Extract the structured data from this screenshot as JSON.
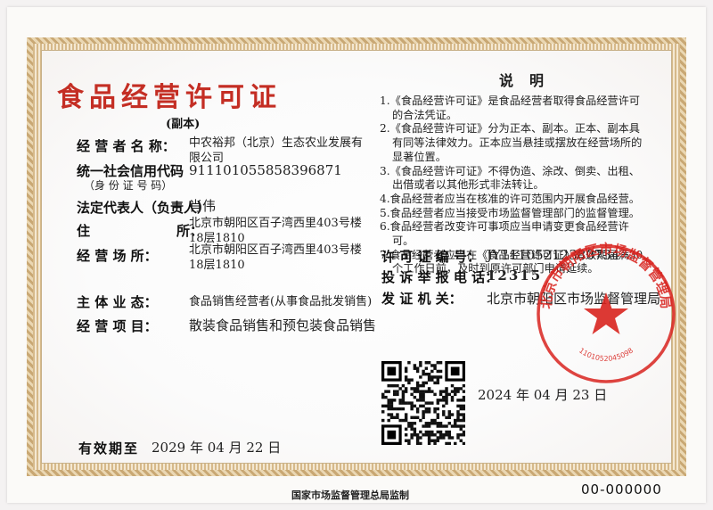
{
  "license": {
    "title": "食品经营许可证",
    "subtitle": "(副本)",
    "operator_label": "经 营 者 名 称：",
    "operator_value": "中农裕邦（北京）生态农业发展有限公司",
    "credit_code_label": "统一社会信用代码",
    "credit_code_sub": "（身 份 证 号 码）",
    "credit_code_value": "911101055858396871",
    "legal_rep_label": "法定代表人（负责人）",
    "legal_rep_value": "肖伟",
    "address_label": "住             所：",
    "address_value": "北京市朝阳区百子湾西里403号楼18层1810",
    "premises_label": "经   营   场   所：",
    "premises_value": "北京市朝阳区百子湾西里403号楼18层1810",
    "main_type_label": "主    体    业    态：",
    "main_type_value": "食品销售经营者(从事食品批发销售)",
    "items_label": "经    营    项    目：",
    "items_value": "散装食品销售和预包装食品销售",
    "validity_label": "有效期至",
    "validity_value": "2029 年 04 月 22 日"
  },
  "notes": {
    "title": "说明",
    "items": [
      "1.《食品经营许可证》是食品经营者取得食品经营许可的合法凭证。",
      "2.《食品经营许可证》分为正本、副本。正本、副本具有同等法律效力。正本应当悬挂或摆放在经营场所的显著位置。",
      "3.《食品经营许可证》不得伪造、涂改、倒卖、出租、出借或者以其他形式非法转让。",
      "4.食品经营者应当在核准的许可范围内开展食品经营。",
      "5.食品经营者应当接受市场监督管理部门的监督管理。",
      "6.食品经营者改变许可事项应当申请变更食品经营许可。",
      "7.食品经营者应当在《食品经营许可证》有效期届满30个工作日前，及时到原许可部门申请延续。"
    ]
  },
  "permit": {
    "number_label": "许 可 证 编 号：",
    "number_value": "JY11105212380734",
    "complaint_label": "投 诉 举 报 电 话：",
    "complaint_value": "12315",
    "issuer_label": "发    证    机    关：",
    "issuer_value": "北京市朝阳区市场监督管理局",
    "issue_date": "2024 年   04 月  23 日"
  },
  "seal": {
    "text": "北京市朝阳区市场监督管理局",
    "code": "1101052045098",
    "color": "#d8231e"
  },
  "footer": {
    "supervisor": "国家市场监督管理总局监制",
    "serial": "00-000000"
  },
  "colors": {
    "title": "#c42e24",
    "border": "#c9a874"
  }
}
